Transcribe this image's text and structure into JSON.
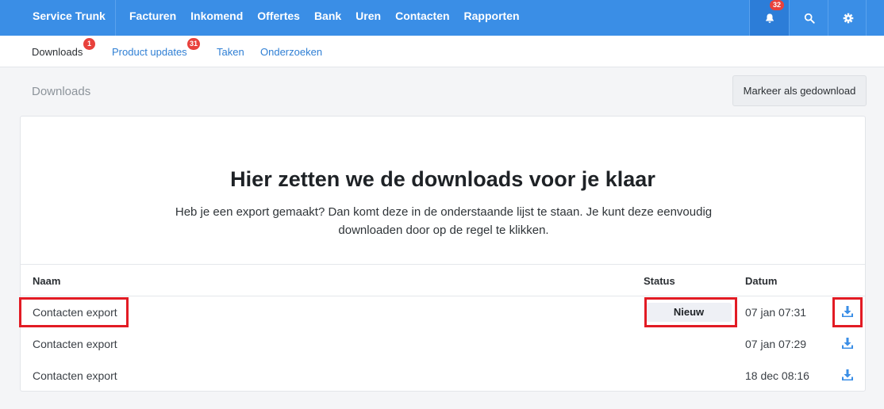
{
  "topbar": {
    "brand": "Service Trunk",
    "nav": [
      "Facturen",
      "Inkomend",
      "Offertes",
      "Bank",
      "Uren",
      "Contacten",
      "Rapporten"
    ],
    "notification_count": "32"
  },
  "subnav": {
    "tabs": [
      {
        "label": "Downloads",
        "badge": "1",
        "active": true
      },
      {
        "label": "Product updates",
        "badge": "31",
        "active": false
      },
      {
        "label": "Taken",
        "badge": "",
        "active": false
      },
      {
        "label": "Onderzoeken",
        "badge": "",
        "active": false
      }
    ]
  },
  "page": {
    "title": "Downloads",
    "mark_button": "Markeer als gedownload"
  },
  "hero": {
    "title": "Hier zetten we de downloads voor je klaar",
    "text": "Heb je een export gemaakt? Dan komt deze in de onderstaande lijst te staan. Je kunt deze eenvoudig downloaden door op de regel te klikken."
  },
  "table": {
    "headers": {
      "name": "Naam",
      "status": "Status",
      "date": "Datum"
    },
    "rows": [
      {
        "name": "Contacten export",
        "status": "Nieuw",
        "date": "07 jan 07:31"
      },
      {
        "name": "Contacten export",
        "status": "",
        "date": "07 jan 07:29"
      },
      {
        "name": "Contacten export",
        "status": "",
        "date": "18 dec 08:16"
      }
    ]
  },
  "colors": {
    "topbar": "#3a8ee6",
    "badge": "#e8413c",
    "highlight": "#e21b24",
    "link": "#2f7fd4"
  }
}
